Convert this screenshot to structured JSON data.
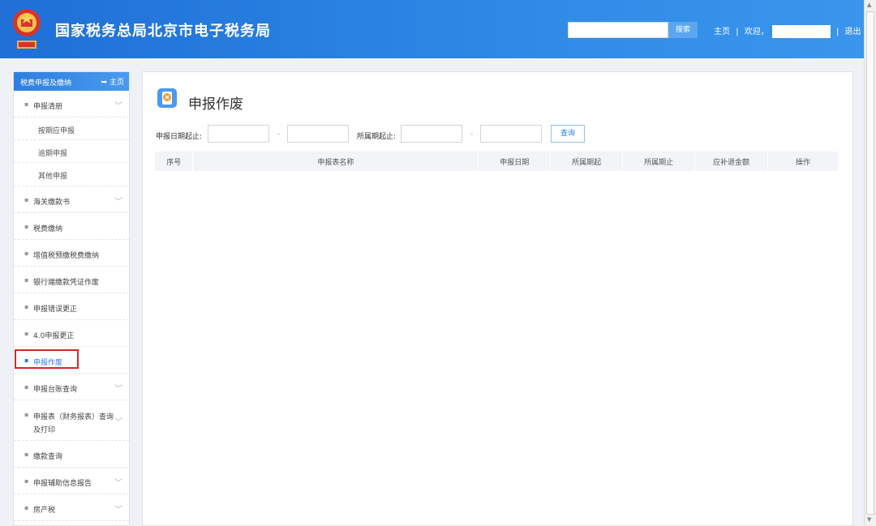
{
  "header": {
    "site_title": "国家税务总局北京市电子税务局",
    "search_placeholder": "",
    "search_button": "搜索",
    "home_link": "主页",
    "separator": "|",
    "welcome": "欢迎，",
    "logout": "退出",
    "brand_color": "#2e8ae6"
  },
  "sidebar": {
    "title": "税费申报及缴纳",
    "home": "主页",
    "items": [
      {
        "label": "申报清册",
        "expandable": true
      },
      {
        "label": "按期应申报",
        "sub": true
      },
      {
        "label": "逾期申报",
        "sub": true
      },
      {
        "label": "其他申报",
        "sub": true
      },
      {
        "label": "海关缴款书",
        "expandable": true
      },
      {
        "label": "税费缴纳"
      },
      {
        "label": "增值税预缴税费缴纳"
      },
      {
        "label": "银行端缴款凭证作废"
      },
      {
        "label": "申报错误更正"
      },
      {
        "label": "4.0申报更正"
      },
      {
        "label": "申报作废",
        "active": true
      },
      {
        "label": "申报台账查询",
        "expandable": true
      },
      {
        "label": "申报表（财务报表）查询",
        "label2": "及打印",
        "expandable": true
      },
      {
        "label": "缴款查询"
      },
      {
        "label": "申报辅助信息报告",
        "expandable": true
      },
      {
        "label": "房产税",
        "expandable": true
      }
    ]
  },
  "main": {
    "title": "申报作废",
    "filter": {
      "declare_date_label": "申报日期起止:",
      "period_label": "所属期起止:",
      "dash": "-",
      "query_button": "查询"
    },
    "table": {
      "columns": [
        "序号",
        "申报表名称",
        "申报日期",
        "所属期起",
        "所属期止",
        "应补退金额",
        "操作"
      ]
    }
  }
}
